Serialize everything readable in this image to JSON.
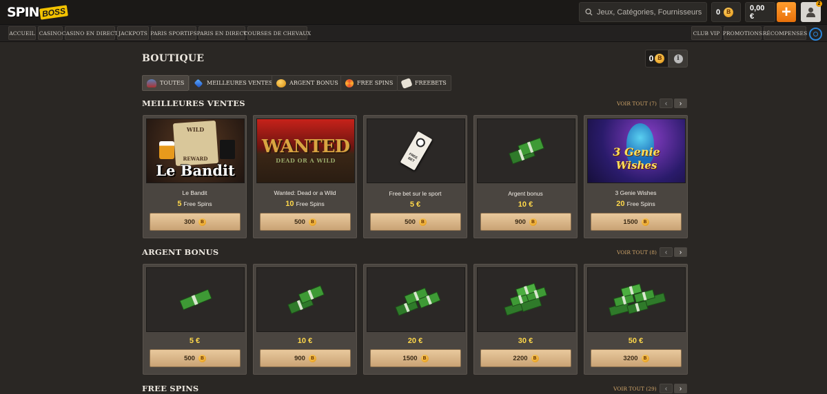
{
  "header": {
    "logo_main": "SPIN",
    "logo_sub": "BOSS",
    "search_placeholder": "Jeux, Catégories, Fournisseurs",
    "coins": "0",
    "wallet": "0,00 €",
    "plus": "+",
    "notifications": "2"
  },
  "nav": {
    "items": [
      "Accueil",
      "Casino",
      "Casino en direct",
      "Jackpots",
      "Paris sportifs",
      "Paris en direct",
      "Courses de chevaux"
    ],
    "right": [
      "Club VIP",
      "Promotions",
      "Récompenses"
    ]
  },
  "shop": {
    "title": "BOUTIQUE",
    "balance": "0",
    "info": "i",
    "filters": [
      "Toutes",
      "Meilleures ventes",
      "Argent bonus",
      "Free spins",
      "Freebets"
    ],
    "coin_symbol": "B"
  },
  "sections": [
    {
      "title": "MEILLEURES VENTES",
      "see_all": "VOIR TOUT (7)",
      "cards": [
        {
          "name": "Le Bandit",
          "value": "5",
          "unit": "Free Spins",
          "price": "300",
          "art": "Le Bandit",
          "art_sub": "WILD",
          "art_sub2": "REWARD"
        },
        {
          "name": "Wanted: Dead or a Wild",
          "value": "10",
          "unit": "Free Spins",
          "price": "500",
          "art": "WANTED",
          "art_sub": "DEAD OR A WILD"
        },
        {
          "name": "Free bet sur le sport",
          "value": "5 €",
          "unit": "",
          "price": "500",
          "art_sub": "FREE BET"
        },
        {
          "name": "Argent bonus",
          "value": "10 €",
          "unit": "",
          "price": "900"
        },
        {
          "name": "3 Genie Wishes",
          "value": "20",
          "unit": "Free Spins",
          "price": "1500",
          "art": "3 Genie",
          "art_sub": "Wishes"
        }
      ]
    },
    {
      "title": "ARGENT BONUS",
      "see_all": "VOIR TOUT (8)",
      "cards": [
        {
          "value": "5 €",
          "price": "500"
        },
        {
          "value": "10 €",
          "price": "900"
        },
        {
          "value": "20 €",
          "price": "1500"
        },
        {
          "value": "30 €",
          "price": "2200"
        },
        {
          "value": "50 €",
          "price": "3200"
        }
      ]
    },
    {
      "title": "FREE SPINS",
      "see_all": "VOIR TOUT (29)"
    }
  ],
  "colors": {
    "accent_gold": "#ffd84a",
    "orange": "#e8700a",
    "buy_button": "#c9a375"
  }
}
